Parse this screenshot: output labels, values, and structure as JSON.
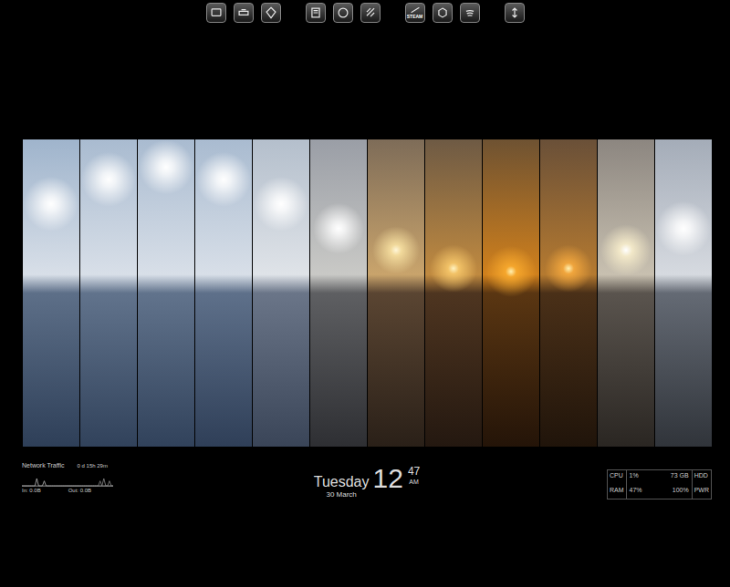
{
  "dock": {
    "groups": [
      {
        "items": [
          {
            "label": ""
          },
          {
            "label": ""
          },
          {
            "label": ""
          }
        ]
      },
      {
        "items": [
          {
            "label": ""
          },
          {
            "label": ""
          },
          {
            "label": ""
          }
        ]
      },
      {
        "items": [
          {
            "label": "STEAM"
          },
          {
            "label": ""
          },
          {
            "label": ""
          }
        ]
      },
      {
        "items": [
          {
            "label": ""
          }
        ]
      }
    ]
  },
  "network": {
    "title": "Network Traffic",
    "uptime": "0 d 15h 29m",
    "in_label": "In: 0.0B",
    "out_label": "Out: 0.0B",
    "series": {
      "in": [
        0,
        0,
        0,
        0,
        0,
        0,
        0,
        0,
        3,
        0,
        0,
        0,
        2,
        0,
        0,
        0,
        0,
        0,
        0,
        0,
        0,
        0,
        0,
        0,
        0,
        0,
        0,
        0,
        0,
        0,
        0,
        0,
        0,
        0,
        0,
        0,
        0,
        0,
        0,
        0,
        0,
        0,
        0,
        0,
        0,
        0,
        0,
        0,
        0,
        0
      ],
      "out": [
        0,
        0,
        0,
        0,
        0,
        0,
        0,
        0,
        0,
        0,
        0,
        0,
        0,
        0,
        0,
        0,
        0,
        0,
        0,
        0,
        0,
        0,
        0,
        0,
        0,
        0,
        0,
        0,
        0,
        0,
        0,
        0,
        0,
        0,
        0,
        0,
        0,
        0,
        0,
        0,
        0,
        0,
        2,
        0,
        3,
        0,
        0,
        2,
        0,
        0
      ]
    }
  },
  "clock": {
    "day": "Tuesday",
    "hour": "12",
    "minute": "47",
    "ampm": "AM",
    "date": "30 March"
  },
  "system": {
    "rows": [
      {
        "label": "CPU",
        "value": "1%",
        "value2": "73 GB",
        "label2": "HDD"
      },
      {
        "label": "RAM",
        "value": "47%",
        "value2": "100%",
        "label2": "PWR"
      }
    ]
  }
}
